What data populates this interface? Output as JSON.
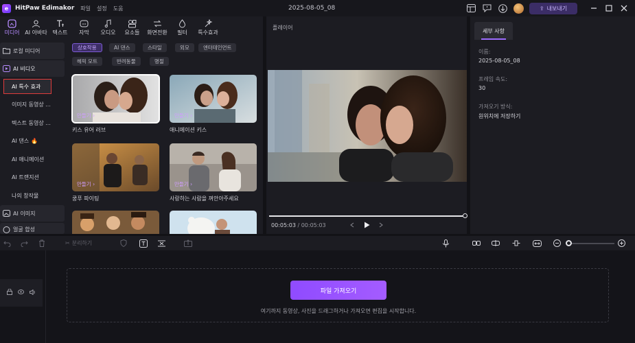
{
  "app": {
    "logo_letter": "e",
    "title": "HitPaw Edimakor",
    "menu": [
      "파일",
      "설정",
      "도움"
    ],
    "document_title": "2025-08-05_08",
    "export_label": "내보내기"
  },
  "toolbar": {
    "tools": [
      {
        "label": "미디어",
        "icon": "media-icon",
        "active": true
      },
      {
        "label": "AI 아바타",
        "icon": "avatar-icon",
        "active": false
      },
      {
        "label": "텍스트",
        "icon": "text-icon",
        "active": false
      },
      {
        "label": "자막",
        "icon": "subtitle-icon",
        "active": false
      },
      {
        "label": "오디오",
        "icon": "music-note-icon",
        "active": false
      },
      {
        "label": "요소들",
        "icon": "elements-icon",
        "active": false
      },
      {
        "label": "화면전환",
        "icon": "transition-icon",
        "active": false
      },
      {
        "label": "필터",
        "icon": "filter-icon",
        "active": false
      },
      {
        "label": "특수효과",
        "icon": "effects-icon",
        "active": false
      }
    ]
  },
  "sidebar": {
    "items": [
      {
        "label": "로컬 미디어",
        "type": "group",
        "icon": "folder-icon"
      },
      {
        "label": "AI 비디오",
        "type": "group-active",
        "icon": "ai-video-icon"
      },
      {
        "label": "AI 특수 효과",
        "type": "selected"
      },
      {
        "label": "이미지 동영상 ...",
        "type": "sub"
      },
      {
        "label": "텍스트 동영상 ...",
        "type": "sub"
      },
      {
        "label": "AI 댄스",
        "type": "sub",
        "badge": "🔥"
      },
      {
        "label": "AI 애니메이션",
        "type": "sub"
      },
      {
        "label": "AI 트랜지션",
        "type": "sub"
      },
      {
        "label": "나의 창작물",
        "type": "sub"
      },
      {
        "label": "AI 이미지",
        "type": "group",
        "icon": "ai-image-icon"
      },
      {
        "label": "얼굴 합성",
        "type": "group",
        "icon": "face-swap-icon"
      }
    ]
  },
  "categories": {
    "chips": [
      "상호작용",
      "AI 댄스",
      "스타일",
      "외모",
      "엔터테인먼트",
      "헤픽 모트",
      "반려동물",
      "명절"
    ],
    "active_index": 0
  },
  "effects": {
    "make_label": "만들기 ›",
    "cards": [
      {
        "title": "키스 유어 러브",
        "selected": true
      },
      {
        "title": "애니메이션 키스",
        "selected": false
      },
      {
        "title": "쿵푸 파이팅",
        "selected": false
      },
      {
        "title": "사랑하는 사람을 껴안아주세요",
        "selected": false
      },
      {
        "title": "",
        "selected": false
      },
      {
        "title": "",
        "selected": false
      }
    ]
  },
  "player": {
    "header": "플레이어",
    "current_time": "00:05:03",
    "separator": " / ",
    "duration": "00:05:03",
    "progress": 1.0
  },
  "details": {
    "tab_label": "세부 사항",
    "fields": [
      {
        "label": "이름:",
        "value": "2025-08-05_08"
      },
      {
        "label": "프레임 속도:",
        "value": "30"
      },
      {
        "label": "가져오기 방식:",
        "value": "원위치에 저장하기"
      }
    ]
  },
  "timeline_toolbar": {
    "split_label": "분리하기",
    "zoom_level": 0.05
  },
  "timeline": {
    "import_label": "파일 가져오기",
    "drop_hint": "여기까지 동영상, 사진을 드래그하거나 가져오면 편집을 시작합니다."
  },
  "colors": {
    "accent": "#9d6cff",
    "selection_border": "#e03c3c",
    "background": "#121216",
    "panel": "#1c1c22"
  }
}
